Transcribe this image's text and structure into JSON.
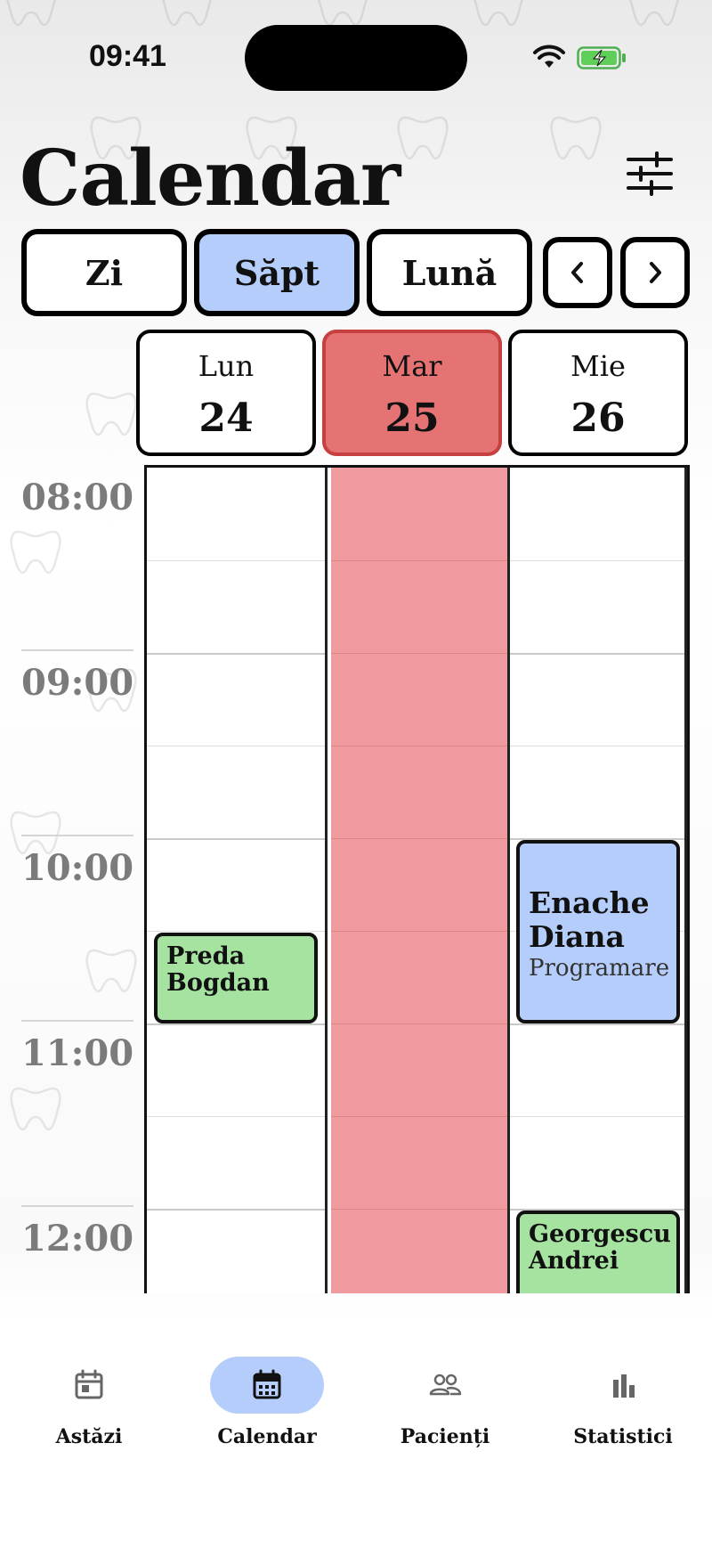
{
  "status_bar": {
    "time": "09:41"
  },
  "header": {
    "title": "Calendar"
  },
  "view_switcher": {
    "options": [
      {
        "label": "Zi",
        "active": false
      },
      {
        "label": "Săpt",
        "active": true
      },
      {
        "label": "Lună",
        "active": false
      }
    ],
    "prev_icon": "chevron-left-icon",
    "next_icon": "chevron-right-icon"
  },
  "days": [
    {
      "name": "Lun",
      "number": "24",
      "today": false
    },
    {
      "name": "Mar",
      "number": "25",
      "today": true
    },
    {
      "name": "Mie",
      "number": "26",
      "today": false
    }
  ],
  "hours": [
    "08:00",
    "09:00",
    "10:00",
    "11:00",
    "12:00"
  ],
  "events": [
    {
      "name": "Preda Bogdan",
      "name_lines": [
        "Preda",
        "Bogdan"
      ],
      "type": "",
      "day": "Lun",
      "color": "#a6e3a1"
    },
    {
      "name": "Enache Diana",
      "name_lines": [
        "Enache",
        "Diana"
      ],
      "type": "Programare",
      "day": "Mie",
      "color": "#b5cdfb"
    },
    {
      "name": "Georgescu Andrei",
      "name_lines": [
        "Georgescu",
        "Andrei"
      ],
      "type": "",
      "day": "Mie",
      "color": "#a6e3a1"
    }
  ],
  "bottom_nav": [
    {
      "label": "Astăzi",
      "icon": "calendar-today-icon",
      "active": false
    },
    {
      "label": "Calendar",
      "icon": "calendar-icon",
      "active": true
    },
    {
      "label": "Pacienți",
      "icon": "users-icon",
      "active": false
    },
    {
      "label": "Statistici",
      "icon": "bar-chart-icon",
      "active": false
    }
  ],
  "colors": {
    "accent": "#b5cdfb",
    "today": "#e57373",
    "today_column": "#ef9a9e",
    "event_green": "#a6e3a1",
    "event_blue": "#b5cdfb"
  }
}
